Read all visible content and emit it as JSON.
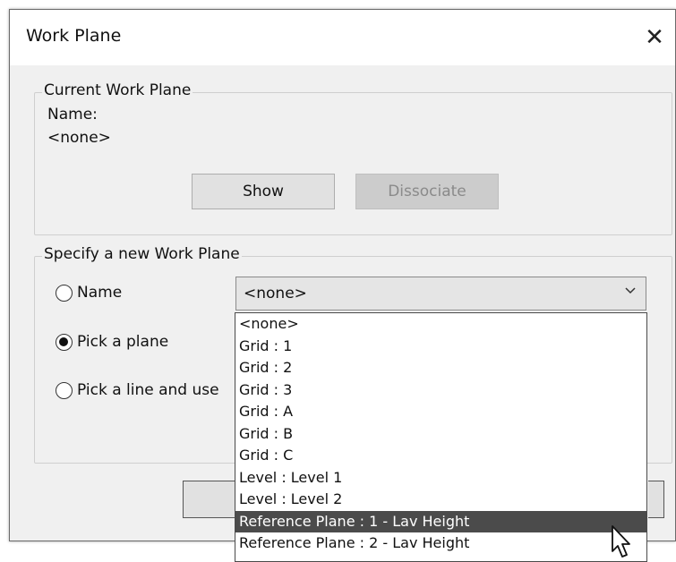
{
  "window": {
    "title": "Work Plane",
    "close_glyph": "✕"
  },
  "current_work_plane": {
    "legend": "Current Work Plane",
    "name_label": "Name:",
    "name_value": "<none>",
    "show_button": "Show",
    "dissociate_button": "Dissociate"
  },
  "specify": {
    "legend": "Specify a new Work Plane",
    "options": [
      {
        "label": "Name",
        "checked": false
      },
      {
        "label": "Pick a plane",
        "checked": true
      },
      {
        "label": "Pick a line and use",
        "checked": false
      }
    ],
    "combo_value": "<none>",
    "combo_arrow_icon": "chevron-down-icon"
  },
  "dropdown": {
    "items": [
      "<none>",
      "Grid : 1",
      "Grid : 2",
      "Grid : 3",
      "Grid : A",
      "Grid : B",
      "Grid : C",
      "Level : Level 1",
      "Level : Level 2",
      "Reference Plane : 1 - Lav Height",
      "Reference Plane : 2 - Lav Height"
    ],
    "selected_index": 9
  },
  "colors": {
    "highlight": "#4b4b4b",
    "dialog_bg": "#f0f0f0"
  }
}
